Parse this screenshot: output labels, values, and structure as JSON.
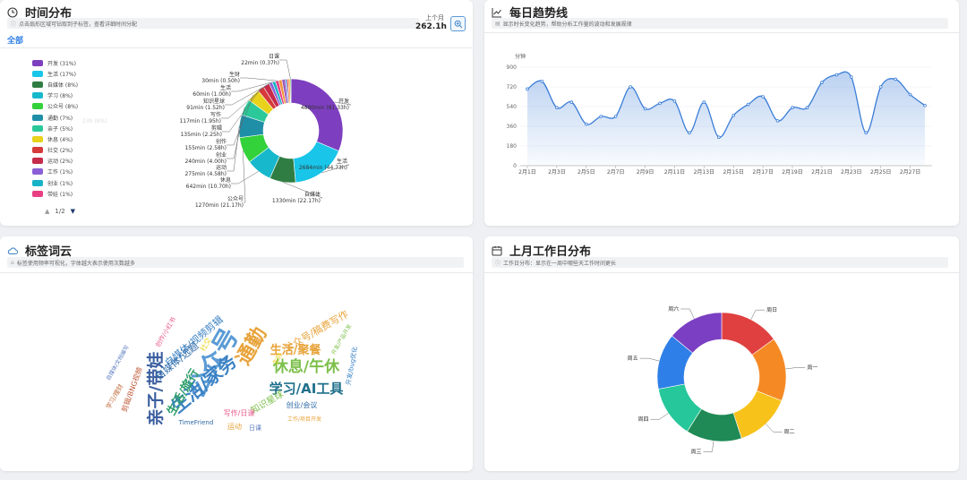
{
  "time_card": {
    "title": "时间分布",
    "hint": "点击扇形区域可钻取到子标签，查看详细时间分配",
    "total_label": "上个月",
    "total_value": "262.1h",
    "filter_all": "全部",
    "pager": "1/2",
    "legend": [
      {
        "label": "开发 (31%)",
        "color": "#7d3fbf"
      },
      {
        "label": "生活 (17%)",
        "color": "#19c5e8"
      },
      {
        "label": "自媒体 (8%)",
        "color": "#2f7d43"
      },
      {
        "label": "学习 (8%)",
        "color": "#18b8cc"
      },
      {
        "label": "公众号 (8%)",
        "color": "#33d13a"
      },
      {
        "label": "通勤 (7%)",
        "color": "#1f8fa8"
      },
      {
        "label": "亲子 (5%)",
        "color": "#2bc999"
      },
      {
        "label": "休息 (4%)",
        "color": "#e8d21c"
      },
      {
        "label": "社交 (2%)",
        "color": "#d63a3a"
      },
      {
        "label": "运动 (2%)",
        "color": "#c62b4a"
      },
      {
        "label": "工作 (1%)",
        "color": "#8a5fd6"
      },
      {
        "label": "创业 (1%)",
        "color": "#16b3c7"
      },
      {
        "label": "带娃 (1%)",
        "color": "#e83f83"
      }
    ],
    "tooltip_ghost": "23h (8%)",
    "pie_values": [
      31,
      17,
      8,
      8,
      8,
      7,
      5,
      4,
      2,
      2,
      1,
      1,
      1,
      1,
      1,
      0.5,
      0.5,
      0.5,
      0.3
    ],
    "pie_extra_colors": [
      "#f0953a",
      "#9b59b6",
      "#3b82f6",
      "#e74c3c",
      "#f39c12",
      "#27ae60"
    ],
    "pie_labels": [
      {
        "name": "开发",
        "value": "4880min (81.33h)"
      },
      {
        "name": "生活",
        "value": "2684min (44.73h)"
      },
      {
        "name": "自媒体",
        "value": "1330min (22.17h)"
      },
      {
        "name": "公众号",
        "value": "1270min (21.17h)"
      },
      {
        "name": "休息",
        "value": "642min (10.70h)"
      },
      {
        "name": "运动",
        "value": "275min (4.58h)"
      },
      {
        "name": "创业",
        "value": "240min (4.00h)"
      },
      {
        "name": "创作",
        "value": "155min (2.58h)"
      },
      {
        "name": "剪辑",
        "value": "135min (2.25h)"
      },
      {
        "name": "写作",
        "value": "117min (1.95h)"
      },
      {
        "name": "知识星球",
        "value": "91min (1.52h)"
      },
      {
        "name": "生活",
        "value": "60min (1.00h)"
      },
      {
        "name": "生财",
        "value": "30min (0.50h)"
      },
      {
        "name": "日课",
        "value": "22min (0.37h)"
      }
    ]
  },
  "trend_card": {
    "title": "每日趋势线",
    "hint": "显示时长变化趋势，帮助分析工作量的波动和发展规律",
    "chart_data": {
      "type": "area",
      "ylabel": "分钟",
      "ylim": [
        0,
        900
      ],
      "yticks": [
        "0",
        "180",
        "360",
        "540",
        "720",
        "900"
      ],
      "xticks": [
        "2月1日",
        "2月3日",
        "2月5日",
        "2月7日",
        "2月9日",
        "2月11日",
        "2月13日",
        "2月15日",
        "2月17日",
        "2月19日",
        "2月21日",
        "2月23日",
        "2月25日",
        "2月27日"
      ],
      "values": [
        700,
        770,
        530,
        580,
        380,
        450,
        450,
        720,
        520,
        570,
        590,
        300,
        580,
        260,
        460,
        560,
        630,
        410,
        530,
        530,
        760,
        830,
        810,
        300,
        720,
        790,
        650,
        550
      ],
      "color": "#3b7dd8"
    }
  },
  "cloud_card": {
    "title": "标签词云",
    "hint": "标签使用频率可视化，字体越大表示使用次数越多",
    "words": [
      {
        "text": "公众号",
        "size": 28,
        "color": "#5b9bd5",
        "rotate": -60
      },
      {
        "text": "生活/家务",
        "size": 20,
        "color": "#3b82c4",
        "rotate": -40
      },
      {
        "text": "通勤",
        "size": 22,
        "color": "#e8a33a",
        "rotate": -60
      },
      {
        "text": "亲子/带娃",
        "size": 19,
        "color": "#3b5fa0",
        "rotate": -90
      },
      {
        "text": "休息/午休",
        "size": 17,
        "color": "#7cbf4a",
        "rotate": 0
      },
      {
        "text": "学习/AI工具",
        "size": 15,
        "color": "#1f6f8b",
        "rotate": 0
      },
      {
        "text": "生活/聚餐",
        "size": 13,
        "color": "#e8a33a",
        "rotate": 0
      },
      {
        "text": "公众号/稿费写作",
        "size": 11,
        "color": "#e8a33a",
        "rotate": -30
      },
      {
        "text": "自媒体/视频剪辑",
        "size": 11,
        "color": "#3b82c4",
        "rotate": -40
      },
      {
        "text": "生活/旅行",
        "size": 13,
        "color": "#2e9e6a",
        "rotate": -60
      },
      {
        "text": "自媒体/选题",
        "size": 11,
        "color": "#2e6aa8",
        "rotate": -40
      },
      {
        "text": "知识星球",
        "size": 10,
        "color": "#7cbf4a",
        "rotate": -30
      },
      {
        "text": "创业/会议",
        "size": 8,
        "color": "#2e6aa8",
        "rotate": 0
      },
      {
        "text": "写作/日课",
        "size": 8,
        "color": "#e85a8a",
        "rotate": 0
      },
      {
        "text": "TimeFriend",
        "size": 7,
        "color": "#2e6aa8",
        "rotate": 0
      },
      {
        "text": "剪辑/BNG视频",
        "size": 8,
        "color": "#c05a3a",
        "rotate": -70
      },
      {
        "text": "自媒体/文档编写",
        "size": 6,
        "color": "#5a7bc0",
        "rotate": -60
      },
      {
        "text": "创作/小红书",
        "size": 7,
        "color": "#e85a8a",
        "rotate": -60
      },
      {
        "text": "开发/bug优化",
        "size": 7,
        "color": "#3b82c4",
        "rotate": -80
      },
      {
        "text": "工作/项目开发",
        "size": 6,
        "color": "#e8a33a",
        "rotate": 0
      },
      {
        "text": "运动",
        "size": 8,
        "color": "#e8a33a",
        "rotate": 0
      },
      {
        "text": "日课",
        "size": 7,
        "color": "#5a7bc0",
        "rotate": 0
      },
      {
        "text": "社交",
        "size": 8,
        "color": "#e8d21c",
        "rotate": -60
      },
      {
        "text": "学习/理财",
        "size": 7,
        "color": "#c06a3a",
        "rotate": -60
      },
      {
        "text": "开发/产品开发",
        "size": 6,
        "color": "#7cbf4a",
        "rotate": -60
      },
      {
        "text": "生财",
        "size": 7,
        "color": "#e8d21c",
        "rotate": -60
      }
    ]
  },
  "weekday_card": {
    "title": "上月工作日分布",
    "hint": "工作日分布：显示在一周中哪些天工作时间更长",
    "chart_data": {
      "type": "pie",
      "categories": [
        "周日",
        "周一",
        "周二",
        "周三",
        "周四",
        "周五",
        "周六"
      ],
      "values": [
        15,
        16,
        14,
        14,
        13,
        14,
        14
      ],
      "colors": [
        "#e04040",
        "#f58a24",
        "#f7c21a",
        "#1f8a55",
        "#26c79a",
        "#2f7fe8",
        "#7a3fc2"
      ]
    }
  }
}
